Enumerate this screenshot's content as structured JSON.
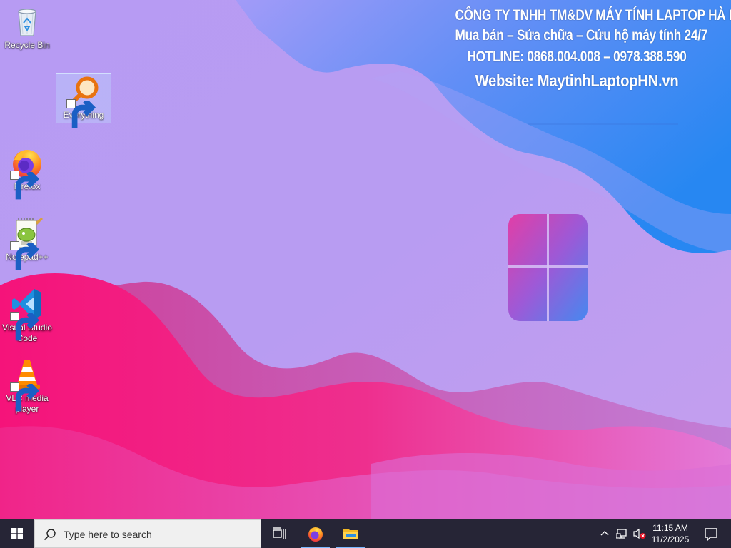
{
  "banner": {
    "line1": "CÔNG TY TNHH TM&DV MÁY TÍNH LAPTOP HÀ NỘI",
    "line2": "Mua bán – Sửa chữa – Cứu hộ máy tính 24/7",
    "line3": "HOTLINE: 0868.004.008 – 0978.388.590",
    "line4": "Website: MaytinhLaptopHN.vn"
  },
  "desktop_icons": [
    {
      "label": "Recycle Bin",
      "icon": "recycle-bin-icon",
      "shortcut": false,
      "selected": false
    },
    {
      "label": "Everything",
      "icon": "everything-search-icon",
      "shortcut": true,
      "selected": true
    },
    {
      "label": "Firefox",
      "icon": "firefox-icon",
      "shortcut": true,
      "selected": false
    },
    {
      "label": "Notepad++",
      "icon": "notepad-plus-plus-icon",
      "shortcut": true,
      "selected": false
    },
    {
      "label": "Visual Studio Code",
      "icon": "vscode-icon",
      "shortcut": true,
      "selected": false
    },
    {
      "label": "VLC media player",
      "icon": "vlc-icon",
      "shortcut": true,
      "selected": false
    }
  ],
  "taskbar": {
    "search_placeholder": "Type here to search",
    "pinned": [
      {
        "name": "Task View",
        "icon": "task-view-icon"
      },
      {
        "name": "Firefox",
        "icon": "firefox-icon",
        "running": true
      },
      {
        "name": "File Explorer",
        "icon": "file-explorer-icon",
        "running": true
      }
    ],
    "clock": {
      "time": "11:15 AM",
      "date": "11/2/2025"
    },
    "tray_icons": [
      "chevron-up-icon",
      "network-icon",
      "volume-muted-icon"
    ]
  },
  "colors": {
    "taskbar_bg": "#262536",
    "wallpaper_lavender": "#b99cf2",
    "wallpaper_pink": "#f0187a",
    "wallpaper_blue": "#2e86f0",
    "running_indicator": "#79b8ff"
  }
}
